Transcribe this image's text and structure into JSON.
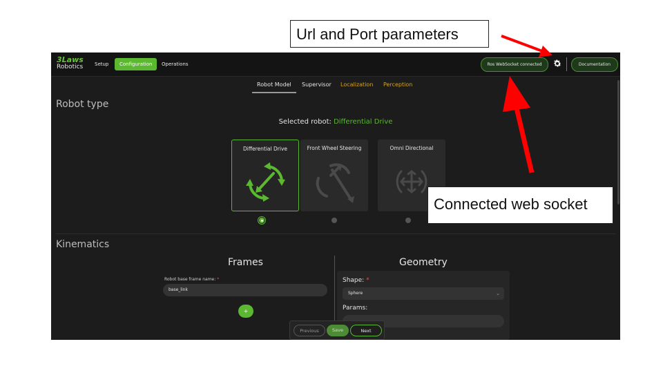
{
  "annotations": {
    "url_port_label": "Url and Port parameters",
    "websocket_label": "Connected web socket",
    "arrow_color": "#ff0000"
  },
  "app": {
    "logo": {
      "line1": "3Laws",
      "line2": "Robotics"
    },
    "nav": [
      "Setup",
      "Configuration",
      "Operations"
    ],
    "active_nav": "Configuration",
    "ws_status": "Ros WebSocket connected",
    "settings_icon": "gear-icon",
    "documentation": "Documentation",
    "tabs": [
      "Robot Model",
      "Supervisor",
      "Localization",
      "Perception"
    ],
    "active_tab": "Robot Model",
    "warning_tabs": [
      "Localization",
      "Perception"
    ],
    "robot_type": {
      "title": "Robot type",
      "selected_label": "Selected robot:",
      "selected_value": "Differential Drive",
      "cards": [
        {
          "label": "Differential Drive",
          "icon": "differential-drive-icon",
          "selected": true
        },
        {
          "label": "Front Wheel Steering",
          "icon": "front-wheel-steering-icon",
          "selected": false
        },
        {
          "label": "Omni Directional",
          "icon": "omni-directional-icon",
          "selected": false
        }
      ]
    },
    "kinematics": {
      "title": "Kinematics",
      "frames": {
        "title": "Frames",
        "base_frame_label": "Robot base frame name:",
        "base_frame_required": "*",
        "base_frame_value": "base_link",
        "add_label": "+"
      },
      "geometry": {
        "title": "Geometry",
        "shape_label": "Shape:",
        "shape_required": "*",
        "shape_value": "Sphere",
        "params_label": "Params:"
      }
    },
    "footer": {
      "previous": "Previous",
      "save": "Save",
      "next": "Next"
    },
    "colors": {
      "accent": "#5bb830",
      "warning": "#d9a41a",
      "background": "#1c1c1c"
    }
  }
}
